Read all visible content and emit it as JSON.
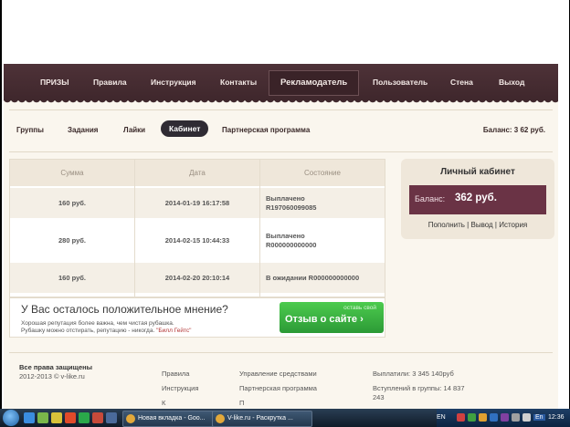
{
  "nav": {
    "items": [
      "ПРИЗЫ",
      "Правила",
      "Инструкция",
      "Контакты",
      "Рекламодатель",
      "Пользователь",
      "Стена",
      "Выход"
    ],
    "active": "Рекламодатель"
  },
  "subnav": {
    "items": [
      "Группы",
      "Задания",
      "Лайки",
      "Кабинет",
      "Партнерская программа"
    ],
    "active": "Кабинет",
    "balance": "Баланс: 3 62 руб."
  },
  "table": {
    "headers": [
      "Сумма",
      "Дата",
      "Состояние"
    ],
    "rows": [
      {
        "sum": "160 руб.",
        "date": "2014-01-19 16:17:58",
        "status1": "Выплачено",
        "status2": "R197060099085"
      },
      {
        "sum": "280 руб.",
        "date": "2014-02-15 10:44:33",
        "status1": "Выплачено",
        "status2": "R000000000000"
      },
      {
        "sum": "160 руб.",
        "date": "2014-02-20 20:10:14",
        "status1": "В ожидании R000000000000",
        "status2": ""
      }
    ]
  },
  "promo": {
    "title": "У Вас осталось положительное мнение?",
    "line1": "Хорошая репутация более важна, чем чистая рубашка.",
    "line2": "Рубашку можно отстирать, репутацию - никогда.",
    "quote": "\"Билл Гейтс\"",
    "button_small": "оставь свой",
    "button_main": "Отзыв о сайте ›"
  },
  "cabinet": {
    "title": "Личный кабинет",
    "balance_label": "Баланс:",
    "balance_value": "362 руб.",
    "links": [
      "Пополнить",
      "Вывод",
      "История"
    ]
  },
  "footer": {
    "rights": "Все права защищены",
    "copyright": "2012-2013 © v-like.ru",
    "col2": [
      "Правила",
      "Инструкция",
      "К"
    ],
    "col3": [
      "Управление средствами",
      "Партнерская программа",
      "П"
    ],
    "payouts": "Выплатили: 3 345 140руб",
    "joins": "Вступлений в группы: 14 837",
    "joins2": "243"
  },
  "taskbar": {
    "tasks": [
      "Новая вкладка - Goo...",
      "V-like.ru - Раскрутка ..."
    ],
    "lang": "EN",
    "lang2": "En",
    "time": "12:36"
  }
}
